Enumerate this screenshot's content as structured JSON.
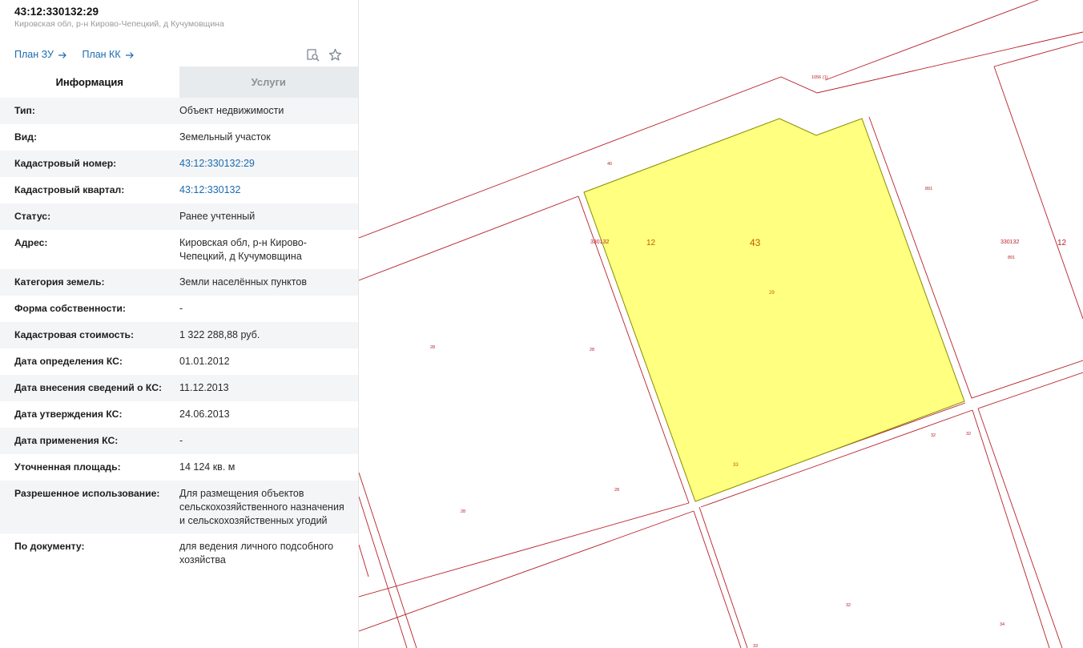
{
  "header": {
    "title": "43:12:330132:29",
    "subtitle": "Кировская обл, р-н Кирово-Чепецкий, д Кучумовщина",
    "link_plan_zu": "План ЗУ",
    "link_plan_kk": "План КК",
    "icons": [
      "search-document-icon",
      "star-icon"
    ]
  },
  "tabs": [
    {
      "label": "Информация",
      "active": true
    },
    {
      "label": "Услуги",
      "active": false
    }
  ],
  "info": [
    {
      "label": "Тип:",
      "value": "Объект недвижимости"
    },
    {
      "label": "Вид:",
      "value": "Земельный участок"
    },
    {
      "label": "Кадастровый номер:",
      "value": "43:12:330132:29",
      "link": true
    },
    {
      "label": "Кадастровый квартал:",
      "value": "43:12:330132",
      "link": true
    },
    {
      "label": "Статус:",
      "value": "Ранее учтенный"
    },
    {
      "label": "Адрес:",
      "value": "Кировская обл, р-н Кирово-Чепецкий, д Кучумовщина"
    },
    {
      "label": "Категория земель:",
      "value": "Земли населённых пунктов"
    },
    {
      "label": "Форма собственности:",
      "value": "-"
    },
    {
      "label": "Кадастровая стоимость:",
      "value": "1 322 288,88 руб."
    },
    {
      "label": "Дата определения КС:",
      "value": "01.01.2012"
    },
    {
      "label": "Дата внесения сведений о КС:",
      "value": "11.12.2013"
    },
    {
      "label": "Дата утверждения КС:",
      "value": "24.06.2013"
    },
    {
      "label": "Дата применения КС:",
      "value": "-"
    },
    {
      "label": "Уточненная площадь:",
      "value": "14 124 кв. м"
    },
    {
      "label": "Разрешенное использование:",
      "value": "Для размещения объектов сельскохозяйственного назначения и сельскохозяйственных угодий"
    },
    {
      "label": "По документу:",
      "value": "для ведения личного подсобного хозяйства"
    }
  ],
  "map": {
    "colors": {
      "boundary": "#b8202a",
      "selected_fill": "#ffff80",
      "selected_stroke": "#8a8a00"
    },
    "labels": {
      "selected_region": "43",
      "selected_district": "12",
      "selected_quarter": "330132",
      "selected_parcel": "29",
      "selected_parcel_2": "33",
      "right_quarter": "330132",
      "right_district": "12",
      "top_parcel": "1056 (1)",
      "road_label": "40",
      "parcel_891a": "891",
      "parcel_891b": "891",
      "parcel_28a": "28",
      "parcel_28b": "28",
      "parcel_28c": "28",
      "parcel_28d": "28",
      "parcel_32a": "32",
      "parcel_32b": "32",
      "parcel_32c": "32",
      "parcel_34": "34",
      "parcel_bottom": "33"
    }
  }
}
